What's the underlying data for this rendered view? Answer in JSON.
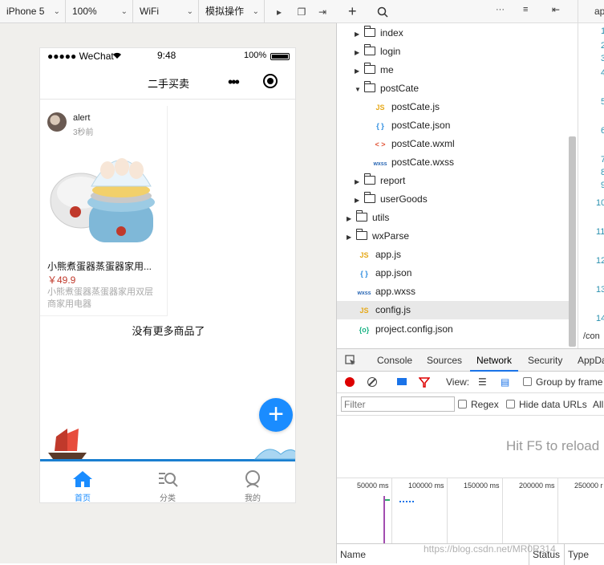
{
  "sim_toolbar": {
    "device": "iPhone 5",
    "zoom": "100%",
    "network": "WiFi",
    "operation": "模拟操作"
  },
  "phone": {
    "carrier": "●●●●● WeChat",
    "time": "9:48",
    "battery": "100%",
    "nav_title": "二手买卖",
    "product": {
      "user": "alert",
      "posted": "3秒前",
      "title": "小熊煮蛋器蒸蛋器家用...",
      "price": "￥49.9",
      "desc": "小熊煮蛋器蒸蛋器家用双层商家用电器"
    },
    "no_more": "没有更多商品了",
    "tabs": [
      {
        "label": "首页"
      },
      {
        "label": "分类"
      },
      {
        "label": "我的"
      }
    ]
  },
  "tree_toolbar": {
    "tab_label": "ap"
  },
  "tree": {
    "items": [
      {
        "name": "index"
      },
      {
        "name": "login"
      },
      {
        "name": "me"
      },
      {
        "name": "postCate"
      },
      {
        "name": "postCate.js",
        "type": "JS"
      },
      {
        "name": "postCate.json",
        "type": "{ }"
      },
      {
        "name": "postCate.wxml",
        "type": "< >"
      },
      {
        "name": "postCate.wxss",
        "type": "wxss"
      },
      {
        "name": "report"
      },
      {
        "name": "userGoods"
      },
      {
        "name": "utils"
      },
      {
        "name": "wxParse"
      },
      {
        "name": "app.js",
        "type": "JS"
      },
      {
        "name": "app.json",
        "type": "{ }"
      },
      {
        "name": "app.wxss",
        "type": "wxss"
      },
      {
        "name": "config.js",
        "type": "JS"
      },
      {
        "name": "project.config.json",
        "type": "{o}"
      }
    ]
  },
  "editor": {
    "line_numbers": [
      "1",
      "2",
      "3",
      "4",
      "5",
      "6",
      "7",
      "8",
      "9",
      "10",
      "11",
      "12",
      "13",
      "14"
    ],
    "footer": "/con"
  },
  "devtools": {
    "tabs": [
      "Console",
      "Sources",
      "Network",
      "Security",
      "AppDa"
    ],
    "view_label": "View:",
    "group_by_frame": "Group by frame",
    "filter_placeholder": "Filter",
    "regex": "Regex",
    "hide_data_urls": "Hide data URLs",
    "all": "All",
    "reload_hint": "Hit F5 to reload",
    "timeline": [
      "50000 ms",
      "100000 ms",
      "150000 ms",
      "200000 ms",
      "250000 r"
    ],
    "columns": [
      "Name",
      "Status",
      "Type"
    ],
    "watermark": "https://blog.csdn.net/MR0R314"
  }
}
